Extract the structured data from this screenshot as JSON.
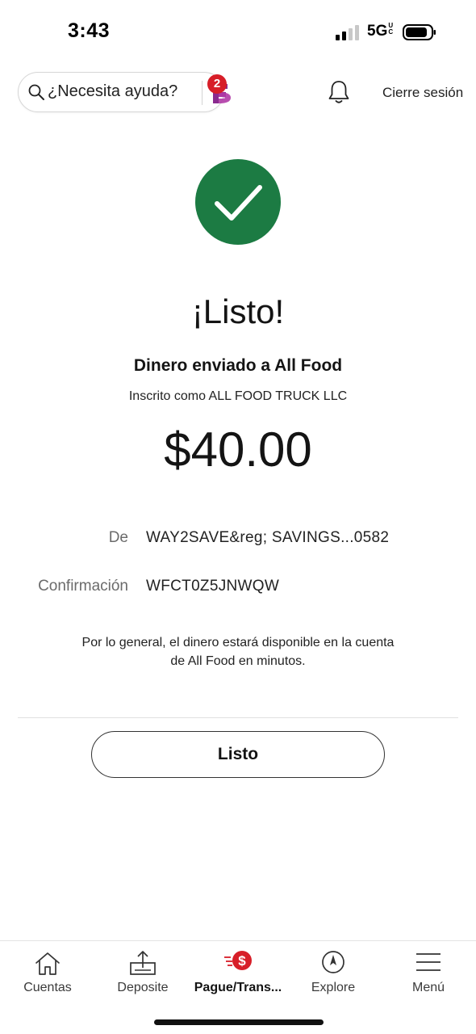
{
  "status_bar": {
    "time": "3:43",
    "network": "5G",
    "network_superscript": "UC"
  },
  "header": {
    "search_placeholder": "¿Necesita ayuda?",
    "assistant_badge_count": "2",
    "signout_label": "Cierre sesión"
  },
  "confirmation": {
    "title": "¡Listo!",
    "subtitle": "Dinero enviado a All Food",
    "registered_as": "Inscrito como ALL FOOD TRUCK LLC",
    "amount": "$40.00",
    "from_label": "De",
    "from_value": "WAY2SAVE&reg; SAVINGS...0582",
    "confirmation_label": "Confirmación",
    "confirmation_value": "WFCT0Z5JNWQW",
    "note": "Por lo general, el dinero estará disponible en la cuenta de All Food en minutos.",
    "done_button": "Listo"
  },
  "bottom_nav": {
    "items": [
      {
        "label": "Cuentas",
        "icon": "home-icon"
      },
      {
        "label": "Deposite",
        "icon": "deposit-icon"
      },
      {
        "label": "Pague/Trans...",
        "icon": "pay-transfer-icon",
        "active": true
      },
      {
        "label": "Explore",
        "icon": "compass-icon"
      },
      {
        "label": "Menú",
        "icon": "hamburger-menu-icon"
      }
    ]
  },
  "colors": {
    "success_green": "#1c7b43",
    "badge_red": "#d71e28",
    "assistant_purple": "#8a2b8f"
  }
}
